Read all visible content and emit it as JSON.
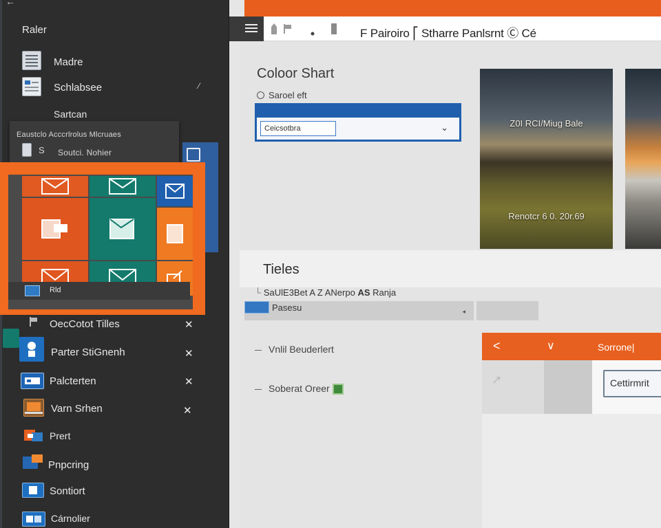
{
  "window": {
    "title": "F Pairoiro ⎡ Stharre Panlsrnt Ⓒ Cé"
  },
  "sidebar": {
    "back_glyph": "←",
    "header": "Raler",
    "items_top": [
      {
        "label": "Madre",
        "icon": "document-stack-icon"
      },
      {
        "label": "Schlabsee",
        "icon": "document-list-icon",
        "caret": "⁄"
      },
      {
        "label": "Sartcan"
      }
    ],
    "popup": {
      "line1": "Eaustclo  Acccrlrolus Mlcruaes",
      "line2": "Soutci. Nohier",
      "icon_glyph": "S"
    },
    "tile_panel": {
      "bar_label": "Rld"
    },
    "items_bottom": [
      {
        "label": "OecCotot Tilles",
        "icon": "flag-icon",
        "close": "✕"
      },
      {
        "label": "Parter StiGnenh",
        "icon": "person-badge-icon",
        "close": "✕"
      },
      {
        "label": "Palcterten",
        "icon": "window-blue-icon",
        "close": "✕"
      },
      {
        "label": "Varn Srhen",
        "icon": "laptop-icon",
        "close": "✕"
      },
      {
        "label": "Prert",
        "icon": "folder-orange-icon"
      },
      {
        "label": "Pnpcring",
        "icon": "cloud-folder-icon"
      },
      {
        "label": "Sontiort",
        "icon": "tablet-icon"
      },
      {
        "label": "Cárnolier",
        "icon": "calendar-icon"
      }
    ]
  },
  "toolbar": {
    "icons": [
      "menu-icon",
      "pencil-icon",
      "flag-icon",
      "dot-icon",
      "save-icon"
    ]
  },
  "main": {
    "title": "Coloor Shart",
    "radio_label": "Saroel eft",
    "select_value": "Ceicsotbra",
    "select_chevron": "⌄",
    "photos": [
      {
        "caption_top": "Z0I RCI/Miug Bale",
        "caption_bottom": "Renotcr 6 0. 20r.69"
      },
      {
        "caption_top": "",
        "caption_bottom": ""
      }
    ],
    "tiles": {
      "title": "Tieles",
      "subtitle_pre": "SaUlE3Bet",
      "subtitle_mid": "A  Z ANerpo",
      "subtitle_bold": "AS",
      "subtitle_post": "Ranja",
      "field_label": "Pasesu",
      "field_arrow": "◂"
    },
    "options": [
      {
        "label": "Vnlil Beuderlert"
      },
      {
        "label": "Soberat Oreer"
      }
    ]
  },
  "card": {
    "prev": "<",
    "next": "∨",
    "title": "Sorrone|",
    "button": "Cettirmrit"
  },
  "colors": {
    "accent_orange": "#e85f1d",
    "accent_blue": "#1f5fae",
    "teal": "#137a6c",
    "sidebar_bg": "#2d2d2d"
  }
}
